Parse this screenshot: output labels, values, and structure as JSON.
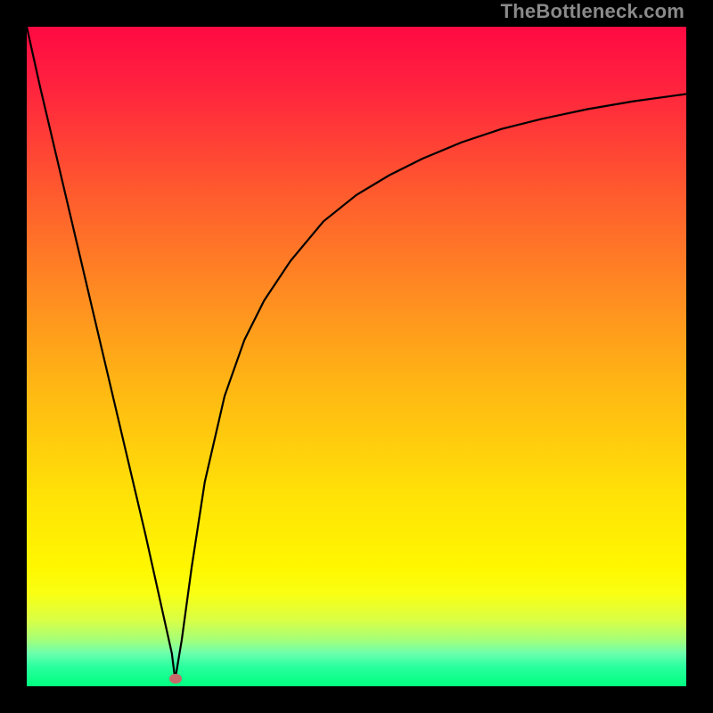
{
  "watermark": "TheBottleneck.com",
  "colors": {
    "gradient_top": "#ff0a42",
    "gradient_bottom": "#00ff7f",
    "curve": "#000000",
    "marker": "#c86a6a",
    "frame": "#000000"
  },
  "chart_data": {
    "type": "line",
    "title": "",
    "xlabel": "",
    "ylabel": "",
    "xlim": [
      0,
      100
    ],
    "ylim": [
      0,
      100
    ],
    "annotations": [
      {
        "type": "marker",
        "x": 22.5,
        "y": 1.2,
        "color": "#c86a6a"
      }
    ],
    "series": [
      {
        "name": "left-branch",
        "x": [
          0,
          2,
          4,
          6,
          8,
          10,
          12,
          14,
          16,
          18,
          20,
          21,
          22,
          22.5
        ],
        "values": [
          100,
          91,
          82.5,
          74,
          65.5,
          57,
          48.5,
          40,
          31.5,
          23,
          14,
          9.5,
          5,
          1
        ]
      },
      {
        "name": "right-branch",
        "x": [
          22.5,
          23.5,
          25,
          27,
          30,
          33,
          36,
          40,
          45,
          50,
          55,
          60,
          66,
          72,
          78,
          85,
          92,
          100
        ],
        "values": [
          1,
          7,
          18,
          31,
          44,
          52.5,
          58.5,
          64.5,
          70.5,
          74.5,
          77.5,
          80,
          82.5,
          84.5,
          86,
          87.5,
          88.7,
          89.8
        ]
      }
    ]
  }
}
